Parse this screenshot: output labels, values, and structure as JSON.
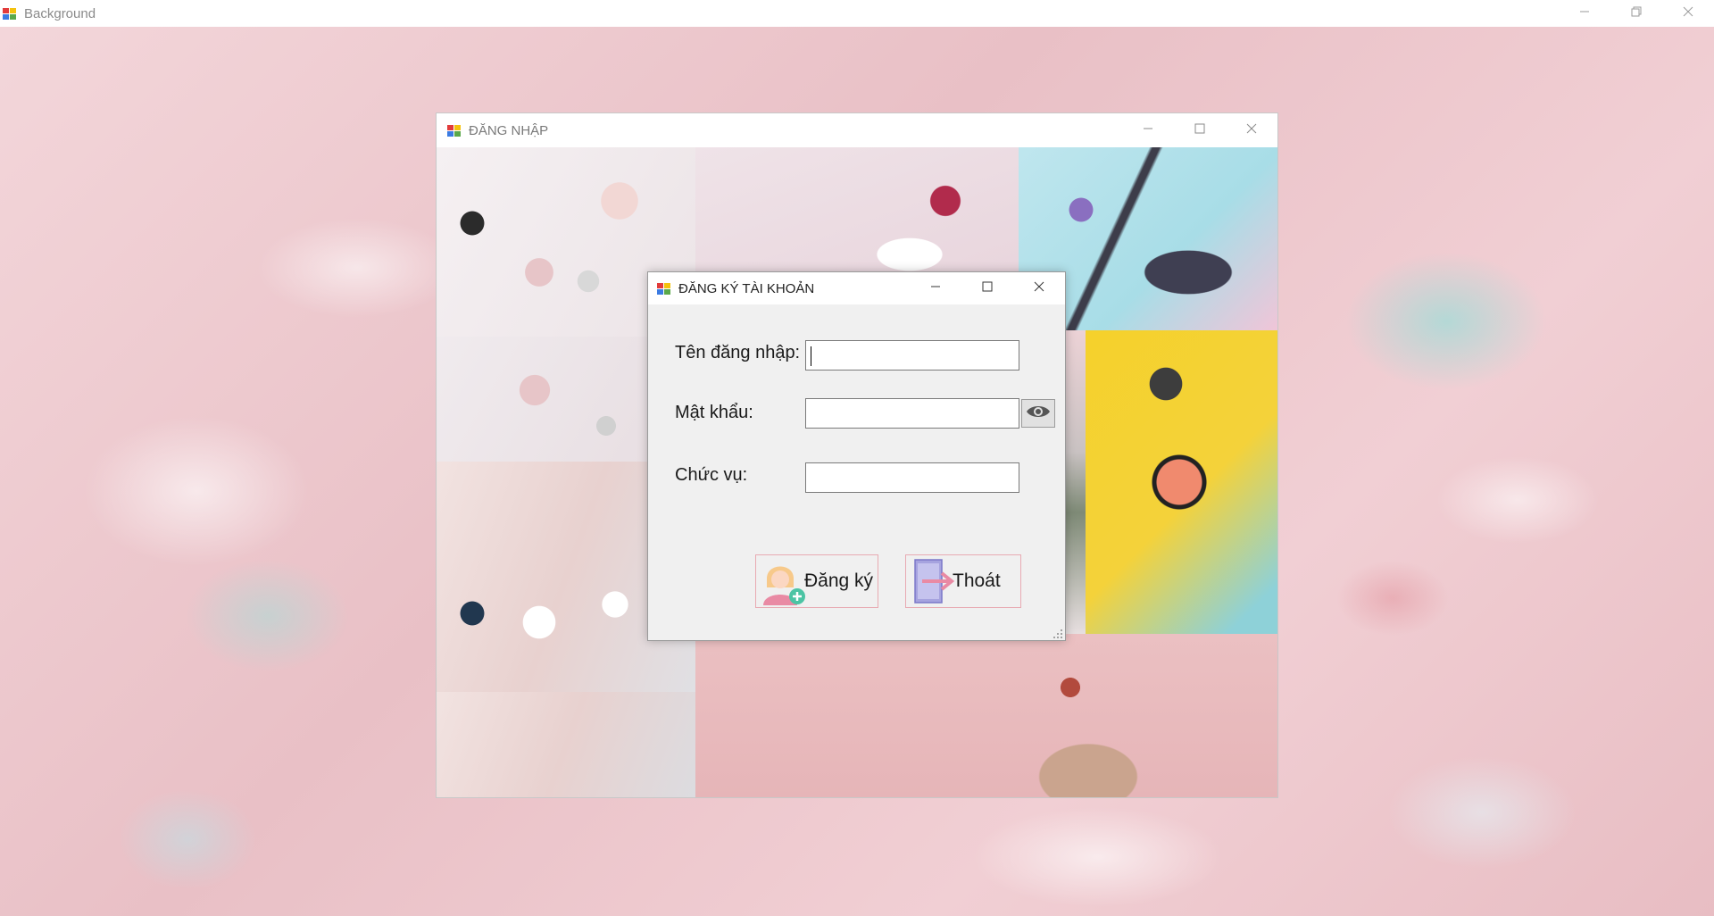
{
  "main_window": {
    "title": "Background",
    "icon": "app-icon",
    "controls": [
      "minimize-icon",
      "restore-icon",
      "close-icon"
    ]
  },
  "login_window": {
    "title": "ĐĂNG NHẬP",
    "icon": "app-icon",
    "controls": [
      "minimize-icon",
      "maximize-icon",
      "close-icon"
    ]
  },
  "register_dialog": {
    "title": "ĐĂNG KÝ TÀI KHOẢN",
    "icon": "app-icon",
    "controls": [
      "minimize-icon",
      "maximize-icon",
      "close-icon"
    ],
    "fields": {
      "username": {
        "label": "Tên đăng nhập:",
        "value": ""
      },
      "password": {
        "label": "Mật khẩu:",
        "value": "",
        "toggle_icon": "eye-icon"
      },
      "role": {
        "label": "Chức vụ:",
        "value": ""
      }
    },
    "buttons": {
      "register": {
        "label": "Đăng ký",
        "icon": "add-user-icon"
      },
      "exit": {
        "label": "Thoát",
        "icon": "exit-icon"
      }
    }
  },
  "colors": {
    "dialog_bg": "#f0f0f0",
    "button_border": "#e8aab2",
    "titlebar_bg": "#ffffff"
  }
}
